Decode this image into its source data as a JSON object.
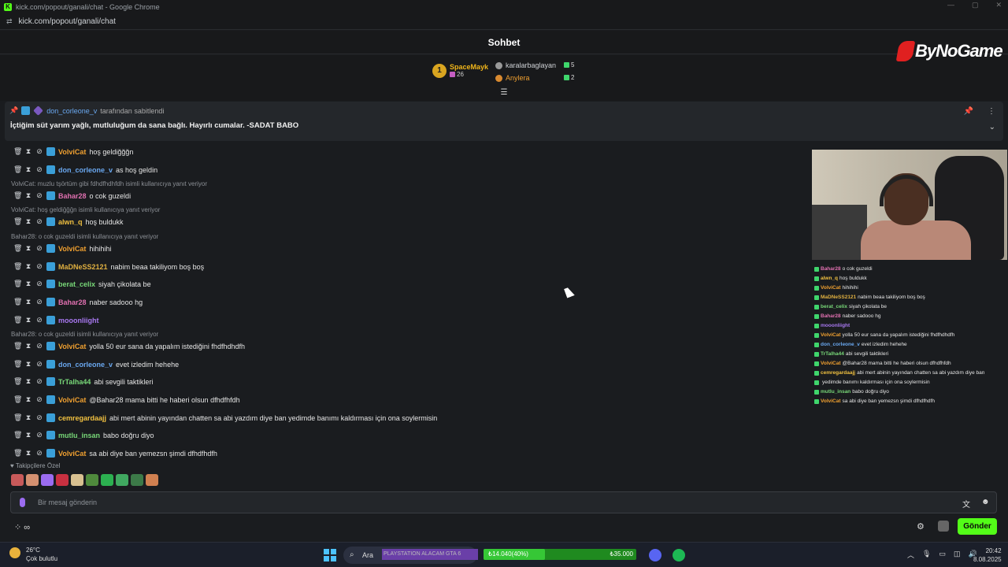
{
  "browser": {
    "title": "kick.com/popout/ganali/chat - Google Chrome",
    "url": "kick.com/popout/ganali/chat"
  },
  "chat_header": {
    "title": "Sohbet"
  },
  "gifters": {
    "top": {
      "rank": "1",
      "name": "SpaceMayk",
      "count": "26"
    },
    "others": [
      {
        "name": "karalarbaglayan",
        "count": "5"
      },
      {
        "name": "Anylera",
        "count": "2"
      }
    ]
  },
  "logo": {
    "text": "ByNoGame"
  },
  "pinned": {
    "pinned_by": "don_corleone_v",
    "pinned_suffix": "tarafından sabitlendi",
    "message": "İçtiğim süt yarım yağlı, mutluluğum da sana bağlı. Hayırlı cumalar. -SADAT BABO"
  },
  "messages": [
    {
      "user": "VolviCat",
      "color": "#f0a030",
      "text": "hoş geldiğğğn"
    },
    {
      "user": "don_corleone_v",
      "color": "#6aa8f0",
      "text": "as hoş geldin"
    },
    {
      "reply": "VolviCat: muzlu tşörtüm gibi fdhdfhdhfdh isimli kullanıcıya yanıt veriyor"
    },
    {
      "user": "Bahar28",
      "color": "#e070b0",
      "text": "o cok guzeldi"
    },
    {
      "reply": "VolviCat: hoş geldiğğğn isimli kullanıcıya yanıt veriyor"
    },
    {
      "user": "alwn_q",
      "color": "#f0c040",
      "text": "hoş buldukk"
    },
    {
      "reply": "Bahar28: o cok guzeldi isimli kullanıcıya yanıt veriyor"
    },
    {
      "user": "VolviCat",
      "color": "#f0a030",
      "text": "hihihihi"
    },
    {
      "user": "MaDNeSS2121",
      "color": "#e0b040",
      "text": "nabim beaa takiliyom boş boş"
    },
    {
      "user": "berat_celix",
      "color": "#78d878",
      "text": "siyah çikolata be"
    },
    {
      "user": "Bahar28",
      "color": "#e070b0",
      "text": "naber sadooo hg"
    },
    {
      "user": "mooonliight",
      "color": "#a878f0",
      "text": ""
    },
    {
      "reply": "Bahar28: o cok guzeldi isimli kullanıcıya yanıt veriyor"
    },
    {
      "user": "VolviCat",
      "color": "#f0a030",
      "text": "yolla 50 eur sana da yapalım istediğini fhdfhdhdfh"
    },
    {
      "user": "don_corleone_v",
      "color": "#6aa8f0",
      "text": "evet izledim hehehe"
    },
    {
      "user": "TrTalha44",
      "color": "#78d878",
      "text": "abi sevgili taktikleri"
    },
    {
      "user": "VolviCat",
      "color": "#f0a030",
      "text": "@Bahar28 mama bitti he haberi olsun dfhdfhfdh"
    },
    {
      "user": "cemregardaajj",
      "color": "#f0c040",
      "text": "abi mert abinin yayından chatten sa abi yazdım diye ban yedimde banımı kaldırması için ona soylermisin"
    },
    {
      "user": "mutlu_insan",
      "color": "#78d878",
      "text": "babo doğru diyo"
    },
    {
      "user": "VolviCat",
      "color": "#f0a030",
      "text": "sa abi diye ban yemezsn şimdi dfhdfhdfh"
    }
  ],
  "followers_label": "Takipçilere Özel",
  "input": {
    "placeholder": "Bir mesaj gönderin"
  },
  "send_label": "Gönder",
  "overlay_chat": [
    {
      "user": "Bahar28",
      "text": "o cok guzeldi",
      "color": "#e070b0"
    },
    {
      "user": "alwn_q",
      "text": "hoş buldukk",
      "color": "#f0c040"
    },
    {
      "user": "VolviCat",
      "text": "hihihihi",
      "color": "#f0a030"
    },
    {
      "user": "MaDNeSS2121",
      "text": "nabim beaa takiliyom boş boş",
      "color": "#e0b040"
    },
    {
      "user": "berat_celix",
      "text": "siyah çikolata be",
      "color": "#78d878"
    },
    {
      "user": "Bahar28",
      "text": "naber sadooo hg",
      "color": "#e070b0"
    },
    {
      "user": "mooonliight",
      "text": "",
      "color": "#a878f0"
    },
    {
      "user": "VolviCat",
      "text": "yolla 50 eur sana da yapalım istediğini fhdfhdhdfh",
      "color": "#f0a030"
    },
    {
      "user": "don_corleone_v",
      "text": "evet izledim hehehe",
      "color": "#6aa8f0"
    },
    {
      "user": "TrTalha44",
      "text": "abi sevgili taktikleri",
      "color": "#78d878"
    },
    {
      "user": "VolviCat",
      "text": "@Bahar28 mama bitti he haberi olsun dfhdfhfdh",
      "color": "#f0a030"
    },
    {
      "user": "cemregardaajj",
      "text": "abi mert abinin yayından chatten sa abi yazdım diye ban",
      "color": "#f0c040"
    },
    {
      "user": "",
      "text": "yedimde banımı kaldırması için ona soylermisin",
      "color": "#e6e6e6"
    },
    {
      "user": "mutlu_insan",
      "text": "babo doğru diyo",
      "color": "#78d878"
    },
    {
      "user": "VolviCat",
      "text": "sa abi diye ban yemezsn şimdi dfhdfhdfh",
      "color": "#f0a030"
    }
  ],
  "taskbar": {
    "temp": "26°C",
    "weather": "Çok bulutlu",
    "search": "Ara",
    "ad_text": "PLAYSTATION ALACAM GTA 6",
    "goal_current": "₺14.040(40%)",
    "goal_target": "₺35.000",
    "goal_progress": 0.4,
    "time": "20:42",
    "date": "8.08.2025"
  }
}
